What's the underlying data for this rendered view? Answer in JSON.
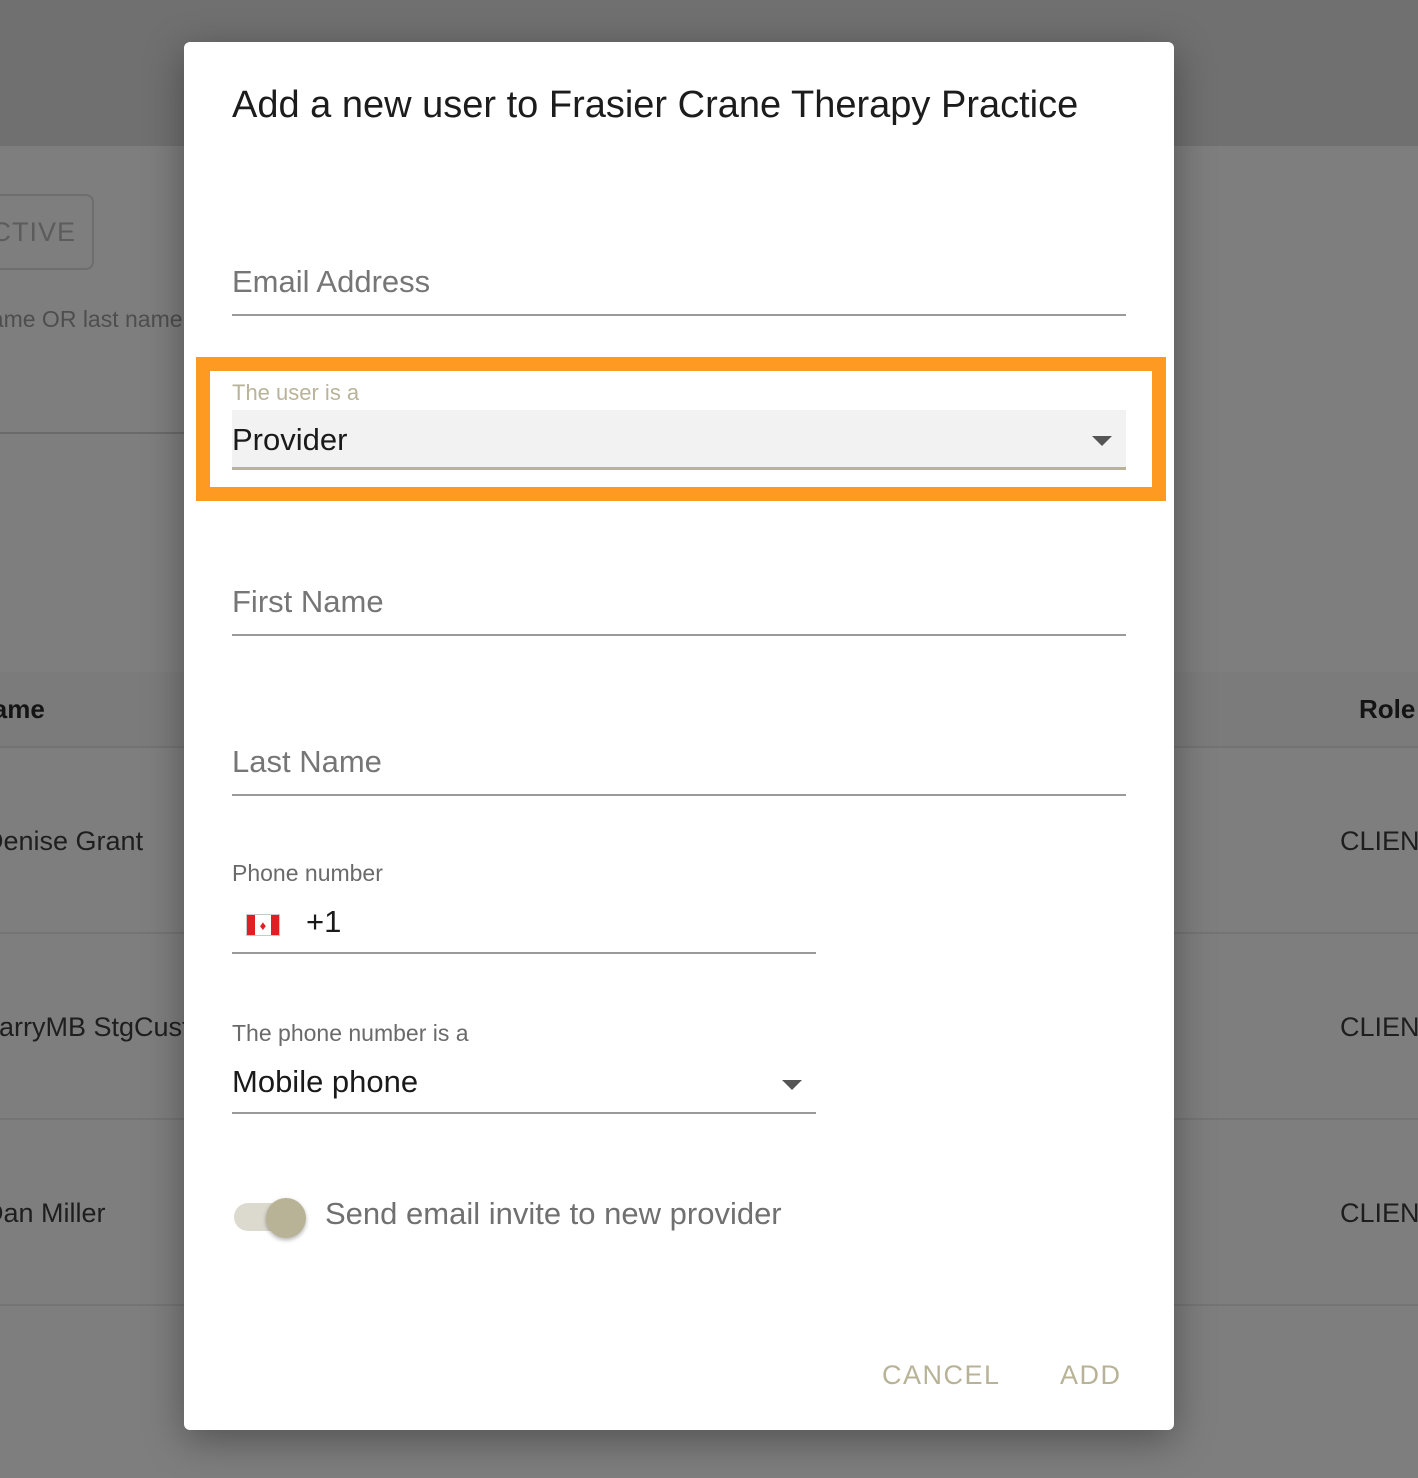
{
  "background": {
    "filter_button_label": "ACTIVE",
    "search_hint": "name OR last name",
    "table": {
      "headers": [
        "Name",
        "Role"
      ],
      "rows": [
        {
          "name": "Denise Grant",
          "role": "CLIENT"
        },
        {
          "name": "LarryMB StgCust",
          "role": "CLIENT"
        },
        {
          "name": "Dan Miller",
          "role": "CLIENT"
        }
      ]
    }
  },
  "dialog": {
    "title": "Add a new user to Frasier Crane Therapy Practice",
    "email": {
      "placeholder": "Email Address",
      "value": ""
    },
    "user_type": {
      "label": "The user is a",
      "value": "Provider"
    },
    "first_name": {
      "placeholder": "First Name",
      "value": ""
    },
    "last_name": {
      "placeholder": "Last Name",
      "value": ""
    },
    "phone": {
      "label": "Phone number",
      "country_flag": "canada-flag-icon",
      "country_code": "+1",
      "value": ""
    },
    "phone_type": {
      "label": "The phone number is a",
      "value": "Mobile phone"
    },
    "send_invite": {
      "label": "Send email invite to new provider",
      "enabled": true
    },
    "actions": {
      "cancel_label": "CANCEL",
      "add_label": "ADD"
    }
  },
  "colors": {
    "highlight": "#fe9a22",
    "accent": "#b8b396",
    "overlay": "#7e7e7e"
  }
}
